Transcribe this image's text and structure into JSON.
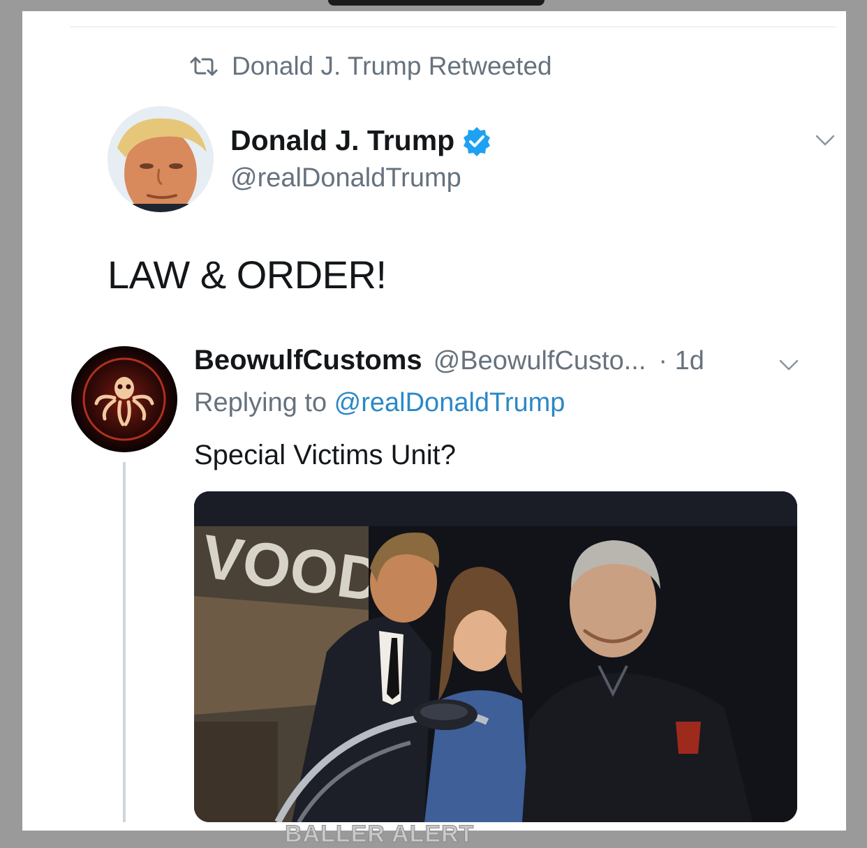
{
  "retweet_banner": {
    "text": "Donald J. Trump Retweeted",
    "icon": "retweet-icon"
  },
  "main_tweet": {
    "name": "Donald J. Trump",
    "handle": "@realDonaldTrump",
    "verified_icon": "verified-badge-icon",
    "text": "LAW & ORDER!",
    "menu_icon": "chevron-down-icon"
  },
  "reply_tweet": {
    "name": "BeowulfCustoms",
    "handle": "@BeowulfCusto...",
    "time": "· 1d",
    "replying_prefix": "Replying to ",
    "replying_to": "@realDonaldTrump",
    "text": "Special Victims Unit?",
    "media_sign_text": "VOOD",
    "menu_icon": "chevron-down-icon"
  },
  "watermark": "BALLER ALERT",
  "colors": {
    "text_primary": "#14171a",
    "text_secondary": "#66727e",
    "link": "#2b88c7",
    "verified": "#1da1f2",
    "thread_line": "#ccd6dd"
  }
}
